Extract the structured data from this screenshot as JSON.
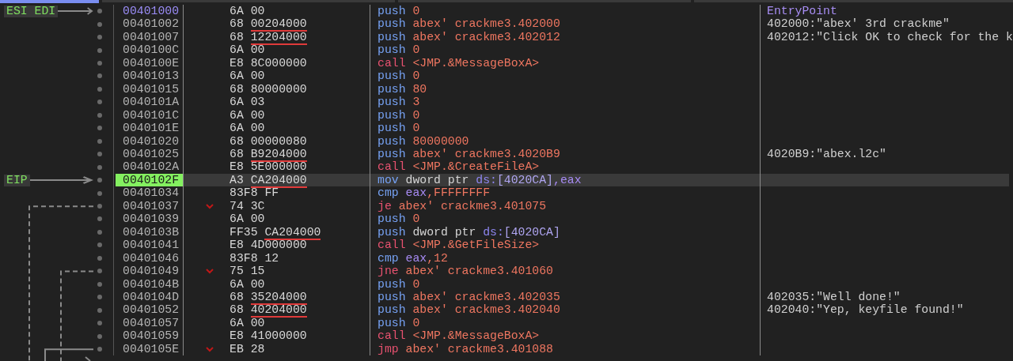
{
  "rows": [
    {
      "address": "00401000",
      "kind": "entry",
      "register_label": "ESI EDI",
      "opcode": "6A",
      "operand": "00",
      "operand_underlined": false,
      "branch": false,
      "mnemonic": {
        "text": "push",
        "kind": "stack"
      },
      "operands": [
        {
          "text": "0",
          "kind": "number",
          "attached": false
        }
      ],
      "comment": {
        "text": "EntryPoint",
        "kind": "label"
      }
    },
    {
      "address": "00401002",
      "kind": "normal",
      "opcode": "68",
      "operand": "00204000",
      "operand_underlined": true,
      "branch": false,
      "mnemonic": {
        "text": "push",
        "kind": "stack"
      },
      "operands": [
        {
          "text": "abex' crackme3.402000",
          "kind": "number",
          "attached": false
        }
      ],
      "comment": {
        "text": "402000:\"abex' 3rd crackme\"",
        "kind": "string"
      }
    },
    {
      "address": "00401007",
      "kind": "normal",
      "opcode": "68",
      "operand": "12204000",
      "operand_underlined": true,
      "branch": false,
      "mnemonic": {
        "text": "push",
        "kind": "stack"
      },
      "operands": [
        {
          "text": "abex' crackme3.402012",
          "kind": "number",
          "attached": false
        }
      ],
      "comment": {
        "text": "402012:\"Click OK to check for the k",
        "kind": "string"
      }
    },
    {
      "address": "0040100C",
      "kind": "normal",
      "opcode": "6A",
      "operand": "00",
      "operand_underlined": false,
      "branch": false,
      "mnemonic": {
        "text": "push",
        "kind": "stack"
      },
      "operands": [
        {
          "text": "0",
          "kind": "number",
          "attached": false
        }
      ]
    },
    {
      "address": "0040100E",
      "kind": "normal",
      "opcode": "E8",
      "operand": "8C000000",
      "operand_underlined": false,
      "branch": false,
      "mnemonic": {
        "text": "call",
        "kind": "call"
      },
      "operands": [
        {
          "text": "<JMP.&MessageBoxA>",
          "kind": "symbol",
          "attached": false
        }
      ]
    },
    {
      "address": "00401013",
      "kind": "normal",
      "opcode": "6A",
      "operand": "00",
      "operand_underlined": false,
      "branch": false,
      "mnemonic": {
        "text": "push",
        "kind": "stack"
      },
      "operands": [
        {
          "text": "0",
          "kind": "number",
          "attached": false
        }
      ]
    },
    {
      "address": "00401015",
      "kind": "normal",
      "opcode": "68",
      "operand": "80000000",
      "operand_underlined": false,
      "branch": false,
      "mnemonic": {
        "text": "push",
        "kind": "stack"
      },
      "operands": [
        {
          "text": "80",
          "kind": "number",
          "attached": false
        }
      ]
    },
    {
      "address": "0040101A",
      "kind": "normal",
      "opcode": "6A",
      "operand": "03",
      "operand_underlined": false,
      "branch": false,
      "mnemonic": {
        "text": "push",
        "kind": "stack"
      },
      "operands": [
        {
          "text": "3",
          "kind": "number",
          "attached": false
        }
      ]
    },
    {
      "address": "0040101C",
      "kind": "normal",
      "opcode": "6A",
      "operand": "00",
      "operand_underlined": false,
      "branch": false,
      "mnemonic": {
        "text": "push",
        "kind": "stack"
      },
      "operands": [
        {
          "text": "0",
          "kind": "number",
          "attached": false
        }
      ]
    },
    {
      "address": "0040101E",
      "kind": "normal",
      "opcode": "6A",
      "operand": "00",
      "operand_underlined": false,
      "branch": false,
      "mnemonic": {
        "text": "push",
        "kind": "stack"
      },
      "operands": [
        {
          "text": "0",
          "kind": "number",
          "attached": false
        }
      ]
    },
    {
      "address": "00401020",
      "kind": "normal",
      "opcode": "68",
      "operand": "00000080",
      "operand_underlined": false,
      "branch": false,
      "mnemonic": {
        "text": "push",
        "kind": "stack"
      },
      "operands": [
        {
          "text": "80000000",
          "kind": "number",
          "attached": false
        }
      ]
    },
    {
      "address": "00401025",
      "kind": "normal",
      "opcode": "68",
      "operand": "B9204000",
      "operand_underlined": true,
      "branch": false,
      "mnemonic": {
        "text": "push",
        "kind": "stack"
      },
      "operands": [
        {
          "text": "abex' crackme3.4020B9",
          "kind": "number",
          "attached": false
        }
      ],
      "comment": {
        "text": "4020B9:\"abex.l2c\"",
        "kind": "string"
      }
    },
    {
      "address": "0040102A",
      "kind": "normal",
      "opcode": "E8",
      "operand": "5E000000",
      "operand_underlined": false,
      "branch": false,
      "mnemonic": {
        "text": "call",
        "kind": "call"
      },
      "operands": [
        {
          "text": "<JMP.&CreateFileA>",
          "kind": "symbol",
          "attached": false
        }
      ]
    },
    {
      "address": "0040102F",
      "kind": "eip",
      "register_label": "EIP",
      "opcode": "A3",
      "operand": "CA204000",
      "operand_underlined": true,
      "branch": false,
      "mnemonic": {
        "text": "mov",
        "kind": "move"
      },
      "operands": [
        {
          "text": "dword ptr",
          "kind": "plain",
          "attached": false
        },
        {
          "text": "ds:",
          "kind": "segment",
          "attached": false
        },
        {
          "text": "[4020CA]",
          "kind": "memory",
          "attached": true
        },
        {
          "text": ",eax",
          "kind": "register",
          "attached": true
        }
      ]
    },
    {
      "address": "00401034",
      "kind": "normal",
      "opcode": "83F8",
      "operand": "FF",
      "operand_underlined": false,
      "branch": false,
      "mnemonic": {
        "text": "cmp",
        "kind": "compare"
      },
      "operands": [
        {
          "text": "eax",
          "kind": "register",
          "attached": false
        },
        {
          "text": ",FFFFFFFF",
          "kind": "number",
          "attached": true
        }
      ]
    },
    {
      "address": "00401037",
      "kind": "normal",
      "opcode": "74",
      "operand": "3C",
      "operand_underlined": false,
      "branch": true,
      "mnemonic": {
        "text": "je",
        "kind": "jump"
      },
      "operands": [
        {
          "text": "abex' crackme3.401075",
          "kind": "number",
          "attached": false
        }
      ]
    },
    {
      "address": "00401039",
      "kind": "normal",
      "opcode": "6A",
      "operand": "00",
      "operand_underlined": false,
      "branch": false,
      "mnemonic": {
        "text": "push",
        "kind": "stack"
      },
      "operands": [
        {
          "text": "0",
          "kind": "number",
          "attached": false
        }
      ]
    },
    {
      "address": "0040103B",
      "kind": "normal",
      "opcode": "FF35",
      "operand": "CA204000",
      "operand_underlined": true,
      "branch": false,
      "mnemonic": {
        "text": "push",
        "kind": "stack"
      },
      "operands": [
        {
          "text": "dword ptr",
          "kind": "plain",
          "attached": false
        },
        {
          "text": "ds:",
          "kind": "segment",
          "attached": false
        },
        {
          "text": "[4020CA]",
          "kind": "memory",
          "attached": true
        }
      ]
    },
    {
      "address": "00401041",
      "kind": "normal",
      "opcode": "E8",
      "operand": "4D000000",
      "operand_underlined": false,
      "branch": false,
      "mnemonic": {
        "text": "call",
        "kind": "call"
      },
      "operands": [
        {
          "text": "<JMP.&GetFileSize>",
          "kind": "symbol",
          "attached": false
        }
      ]
    },
    {
      "address": "00401046",
      "kind": "normal",
      "opcode": "83F8",
      "operand": "12",
      "operand_underlined": false,
      "branch": false,
      "mnemonic": {
        "text": "cmp",
        "kind": "compare"
      },
      "operands": [
        {
          "text": "eax",
          "kind": "register",
          "attached": false
        },
        {
          "text": ",12",
          "kind": "number",
          "attached": true
        }
      ]
    },
    {
      "address": "00401049",
      "kind": "normal",
      "opcode": "75",
      "operand": "15",
      "operand_underlined": false,
      "branch": true,
      "mnemonic": {
        "text": "jne",
        "kind": "jump"
      },
      "operands": [
        {
          "text": "abex' crackme3.401060",
          "kind": "number",
          "attached": false
        }
      ]
    },
    {
      "address": "0040104B",
      "kind": "normal",
      "opcode": "6A",
      "operand": "00",
      "operand_underlined": false,
      "branch": false,
      "mnemonic": {
        "text": "push",
        "kind": "stack"
      },
      "operands": [
        {
          "text": "0",
          "kind": "number",
          "attached": false
        }
      ]
    },
    {
      "address": "0040104D",
      "kind": "normal",
      "opcode": "68",
      "operand": "35204000",
      "operand_underlined": true,
      "branch": false,
      "mnemonic": {
        "text": "push",
        "kind": "stack"
      },
      "operands": [
        {
          "text": "abex' crackme3.402035",
          "kind": "number",
          "attached": false
        }
      ],
      "comment": {
        "text": "402035:\"Well done!\"",
        "kind": "string"
      }
    },
    {
      "address": "00401052",
      "kind": "normal",
      "opcode": "68",
      "operand": "40204000",
      "operand_underlined": true,
      "branch": false,
      "mnemonic": {
        "text": "push",
        "kind": "stack"
      },
      "operands": [
        {
          "text": "abex' crackme3.402040",
          "kind": "number",
          "attached": false
        }
      ],
      "comment": {
        "text": "402040:\"Yep, keyfile found!\"",
        "kind": "string"
      }
    },
    {
      "address": "00401057",
      "kind": "normal",
      "opcode": "6A",
      "operand": "00",
      "operand_underlined": false,
      "branch": false,
      "mnemonic": {
        "text": "push",
        "kind": "stack"
      },
      "operands": [
        {
          "text": "0",
          "kind": "number",
          "attached": false
        }
      ]
    },
    {
      "address": "00401059",
      "kind": "normal",
      "opcode": "E8",
      "operand": "41000000",
      "operand_underlined": false,
      "branch": false,
      "mnemonic": {
        "text": "call",
        "kind": "call"
      },
      "operands": [
        {
          "text": "<JMP.&MessageBoxA>",
          "kind": "symbol",
          "attached": false
        }
      ]
    },
    {
      "address": "0040105E",
      "kind": "normal",
      "opcode": "EB",
      "operand": "28",
      "operand_underlined": false,
      "branch": true,
      "mnemonic": {
        "text": "jmp",
        "kind": "jump"
      },
      "operands": [
        {
          "text": "abex' crackme3.401088",
          "kind": "number",
          "attached": false
        }
      ]
    }
  ]
}
